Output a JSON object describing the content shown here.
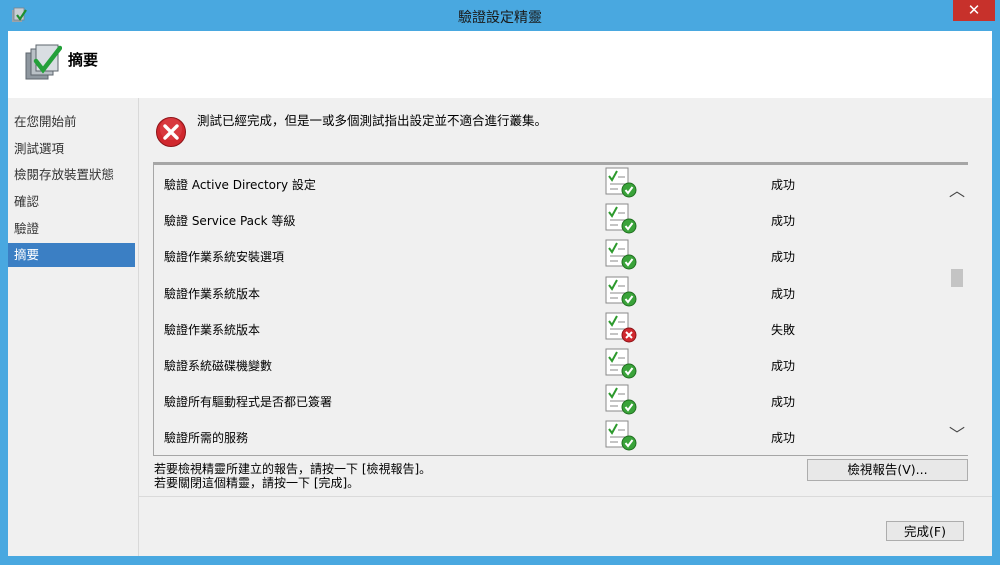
{
  "window": {
    "title": "驗證設定精靈",
    "close_label": "✕"
  },
  "header": {
    "title": "摘要"
  },
  "nav": {
    "items": [
      {
        "label": "在您開始前",
        "active": false
      },
      {
        "label": "測試選項",
        "active": false
      },
      {
        "label": "檢閱存放裝置狀態",
        "active": false
      },
      {
        "label": "確認",
        "active": false
      },
      {
        "label": "驗證",
        "active": false
      },
      {
        "label": "摘要",
        "active": true
      }
    ]
  },
  "main": {
    "status_message": "測試已經完成，但是一或多個測試指出設定並不適合進行叢集。",
    "tests": [
      {
        "name": "驗證 Active Directory 設定",
        "result": "成功",
        "icon": "report-success-icon"
      },
      {
        "name": "驗證 Service Pack 等級",
        "result": "成功",
        "icon": "report-success-icon"
      },
      {
        "name": "驗證作業系統安裝選項",
        "result": "成功",
        "icon": "report-success-icon"
      },
      {
        "name": "驗證作業系統版本",
        "result": "成功",
        "icon": "report-success-icon"
      },
      {
        "name": "驗證作業系統版本",
        "result": "失敗",
        "icon": "report-failure-icon"
      },
      {
        "name": "驗證系統磁碟機變數",
        "result": "成功",
        "icon": "report-success-icon"
      },
      {
        "name": "驗證所有驅動程式是否都已簽署",
        "result": "成功",
        "icon": "report-success-icon"
      },
      {
        "name": "驗證所需的服務",
        "result": "成功",
        "icon": "report-success-icon"
      }
    ],
    "hint_line1": "若要檢視精靈所建立的報告，請按一下 [檢視報告]。",
    "hint_line2": "若要關閉這個精靈，請按一下 [完成]。",
    "view_report_label": "檢視報告(V)...",
    "finish_label": "完成(F)"
  },
  "colors": {
    "titlebar": "#49a8e0",
    "active_nav": "#3b7fc4",
    "success": "#3aa33a",
    "failure": "#d0282e"
  }
}
